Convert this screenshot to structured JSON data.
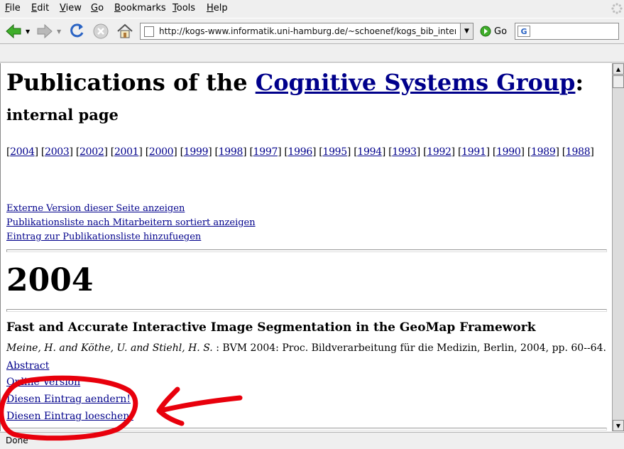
{
  "menubar": {
    "items": [
      "File",
      "Edit",
      "View",
      "Go",
      "Bookmarks",
      "Tools",
      "Help"
    ]
  },
  "navbar": {
    "url": "http://kogs-www.informatik.uni-hamburg.de/~schoenef/kogs_bib_intern.ph",
    "go_label": "Go",
    "search_value": "G"
  },
  "page": {
    "title_prefix": "Publications of the ",
    "title_link": "Cognitive Systems Group",
    "title_suffix": ":",
    "subtitle": "internal page",
    "years": [
      "2004",
      "2003",
      "2002",
      "2001",
      "2000",
      "1999",
      "1998",
      "1997",
      "1996",
      "1995",
      "1994",
      "1993",
      "1992",
      "1991",
      "1990",
      "1989",
      "1988"
    ],
    "links": [
      "Externe Version dieser Seite anzeigen",
      "Publikationsliste nach Mitarbeitern sortiert anzeigen",
      "Eintrag zur Publikationsliste hinzufuegen"
    ],
    "section_year": "2004",
    "entry": {
      "title": "Fast and Accurate Interactive Image Segmentation in the GeoMap Framework",
      "authors": "Meine, H. and Köthe, U. and Stiehl, H. S.",
      "venue": " : BVM 2004: Proc. Bildverarbeitung für die Medizin, Berlin, 2004, pp. 60--64.",
      "abstract_label": "Abstract",
      "online_label": "Online Version",
      "edit_label": "Diesen Eintrag aendern!",
      "delete_label": "Diesen Eintrag loeschen!"
    }
  },
  "status": {
    "text": "Done"
  },
  "colors": {
    "link": "#00008b",
    "annotation": "#e8000c"
  }
}
